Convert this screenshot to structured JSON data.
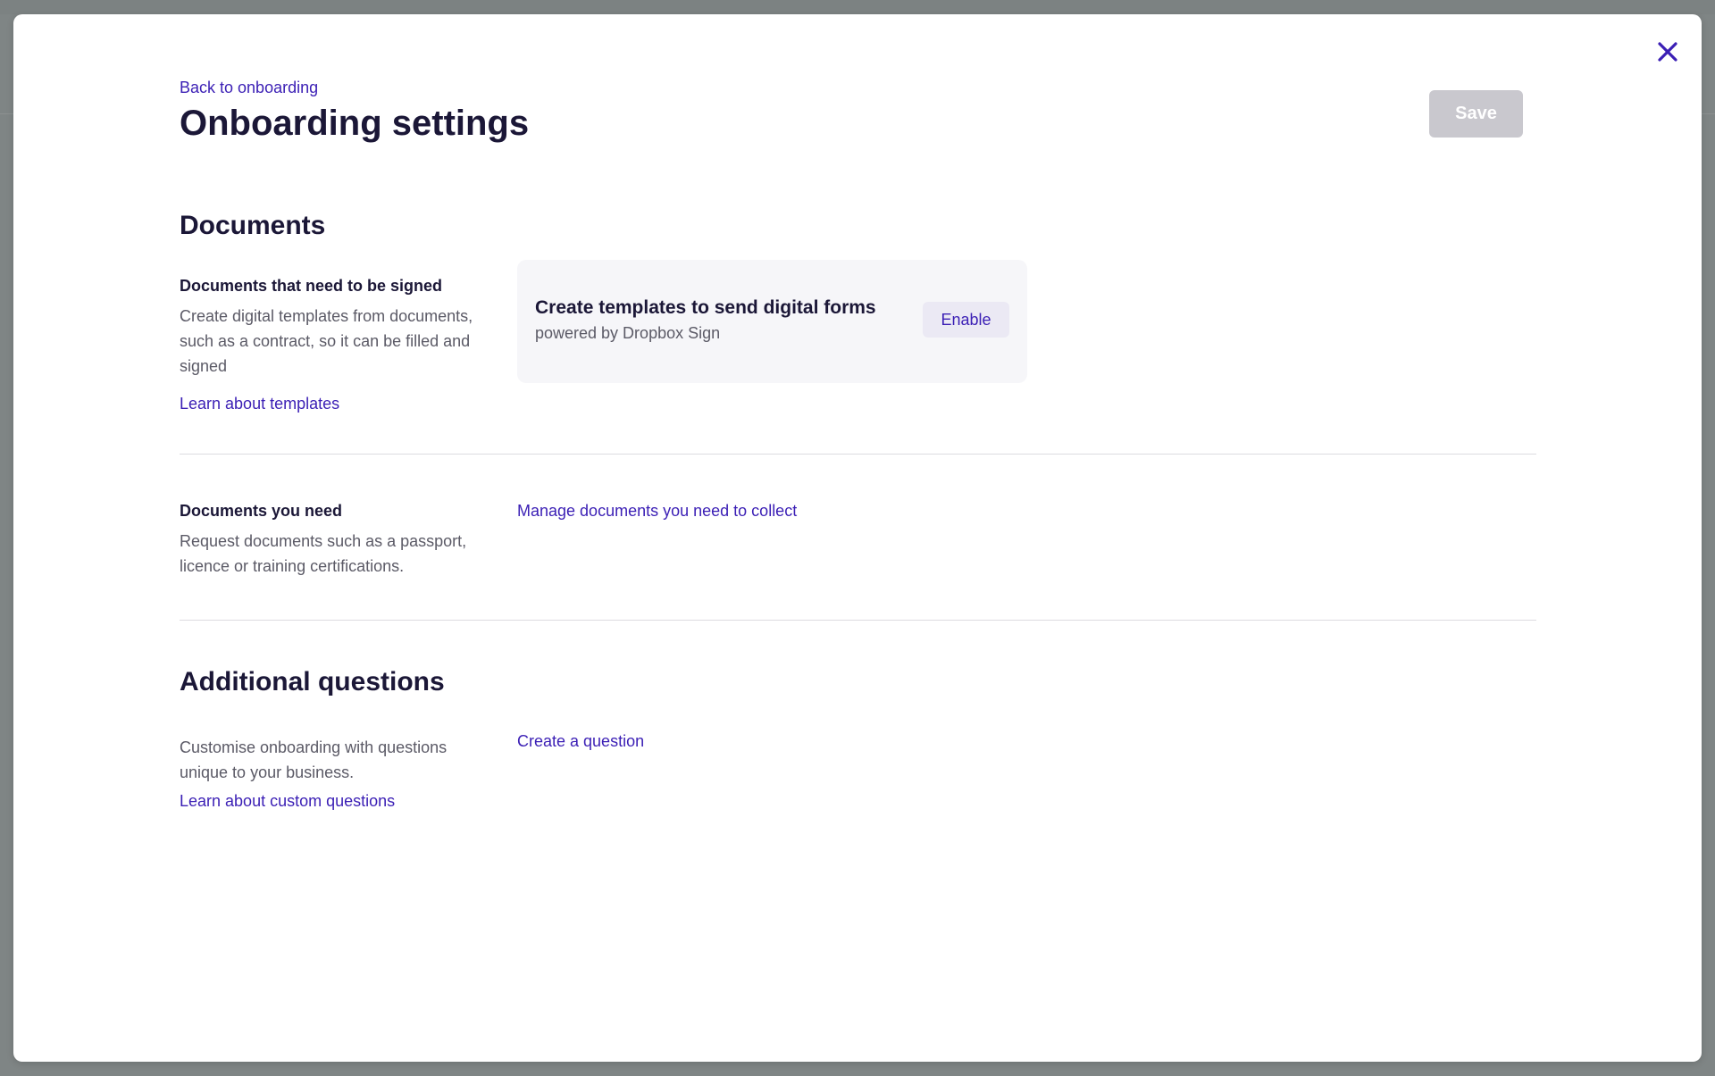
{
  "header": {
    "back_link": "Back to onboarding",
    "title": "Onboarding settings",
    "save_label": "Save",
    "close_icon": "close-icon"
  },
  "documents": {
    "section_title": "Documents",
    "signed": {
      "label": "Documents that need to be signed",
      "description": "Create digital templates from documents, such as a contract, so it can be filled and signed",
      "learn_link": "Learn about templates",
      "card": {
        "title": "Create templates to send digital forms",
        "subtitle": "powered by Dropbox Sign",
        "enable_label": "Enable"
      }
    },
    "needed": {
      "label": "Documents you need",
      "description": "Request documents such as a passport, licence or training certifications.",
      "manage_link": "Manage documents you need to collect"
    }
  },
  "questions": {
    "section_title": "Additional questions",
    "description": "Customise onboarding with questions unique to your business.",
    "learn_link": "Learn about custom questions",
    "create_link": "Create a question"
  },
  "colors": {
    "accent": "#3b1fb5",
    "text_primary": "#1b1737",
    "text_secondary": "#5b5a66",
    "save_disabled": "#c9c8ce",
    "overlay": "#7f8585"
  }
}
